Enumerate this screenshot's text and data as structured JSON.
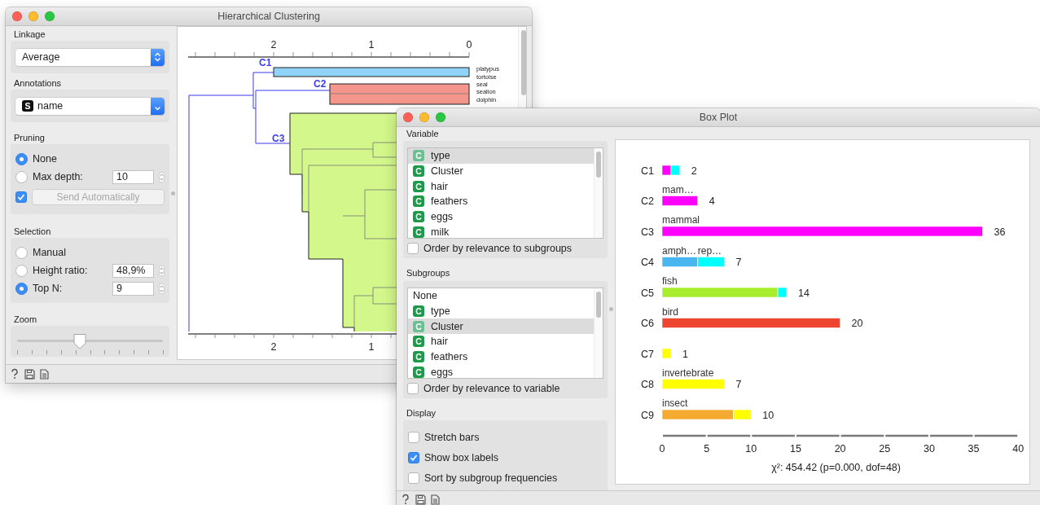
{
  "clustering": {
    "title": "Hierarchical Clustering",
    "linkage": {
      "label": "Linkage",
      "value": "Average"
    },
    "annotations": {
      "label": "Annotations",
      "badge": "S",
      "value": "name"
    },
    "pruning": {
      "label": "Pruning",
      "options": [
        {
          "label": "None",
          "selected": true
        },
        {
          "label": "Max depth:",
          "selected": false,
          "value": "10"
        }
      ],
      "send": {
        "label": "Send Automatically",
        "checked": true,
        "disabled": true
      }
    },
    "selection": {
      "label": "Selection",
      "options": [
        {
          "label": "Manual",
          "selected": false
        },
        {
          "label": "Height ratio:",
          "selected": false,
          "value": "48,9%"
        },
        {
          "label": "Top N:",
          "selected": true,
          "value": "9"
        }
      ]
    },
    "zoom": {
      "label": "Zoom",
      "level": 0.43
    },
    "dendrogram": {
      "top_ticks": [
        "2",
        "1",
        "0"
      ],
      "bottom_ticks": [
        "2",
        "1"
      ],
      "clusters": [
        {
          "label": "C1",
          "color": "#8fd4f8"
        },
        {
          "label": "C2",
          "color": "#f4968b"
        },
        {
          "label": "C3",
          "color": "#d3f78a"
        }
      ],
      "leaves": [
        "platypus",
        "tortoise",
        "seal",
        "sealion",
        "dolphin"
      ]
    }
  },
  "box_plot": {
    "title": "Box Plot",
    "variable": {
      "label": "Variable",
      "items": [
        {
          "kind": "categorical",
          "badge": "C",
          "label": "type",
          "selected": true
        },
        {
          "kind": "categorical",
          "badge": "C",
          "label": "Cluster",
          "selected": false
        },
        {
          "kind": "categorical",
          "badge": "C",
          "label": "hair",
          "selected": false
        },
        {
          "kind": "categorical",
          "badge": "C",
          "label": "feathers",
          "selected": false
        },
        {
          "kind": "categorical",
          "badge": "C",
          "label": "eggs",
          "selected": false
        },
        {
          "kind": "categorical",
          "badge": "C",
          "label": "milk",
          "selected": false
        }
      ],
      "order": {
        "label": "Order by relevance to subgroups",
        "checked": false
      }
    },
    "subgroups": {
      "label": "Subgroups",
      "items": [
        {
          "kind": "none",
          "label": "None",
          "selected": false
        },
        {
          "kind": "categorical",
          "badge": "C",
          "label": "type",
          "selected": false
        },
        {
          "kind": "categorical",
          "badge": "C",
          "label": "Cluster",
          "selected": true
        },
        {
          "kind": "categorical",
          "badge": "C",
          "label": "hair",
          "selected": false
        },
        {
          "kind": "categorical",
          "badge": "C",
          "label": "feathers",
          "selected": false
        },
        {
          "kind": "categorical",
          "badge": "C",
          "label": "eggs",
          "selected": false
        }
      ],
      "order": {
        "label": "Order by relevance to variable",
        "checked": false
      }
    },
    "display": {
      "label": "Display",
      "options": [
        {
          "label": "Stretch bars",
          "checked": false
        },
        {
          "label": "Show box labels",
          "checked": true
        },
        {
          "label": "Sort by subgroup frequencies",
          "checked": false
        }
      ]
    },
    "rows": [
      {
        "count": "2"
      },
      {
        "count": "4",
        "labels": [
          "mam…"
        ]
      },
      {
        "count": "36",
        "labels": [
          "mammal"
        ]
      },
      {
        "count": "7",
        "labels": [
          "amph…",
          "rep…"
        ]
      },
      {
        "count": "14",
        "labels": [
          "fish"
        ]
      },
      {
        "count": "20",
        "labels": [
          "bird"
        ]
      },
      {
        "count": "1"
      },
      {
        "count": "7",
        "labels": [
          "invertebrate"
        ]
      },
      {
        "count": "10",
        "labels": [
          "insect"
        ]
      }
    ],
    "chart_data": {
      "type": "bar",
      "orientation": "horizontal",
      "stacked": true,
      "categories": [
        "C1",
        "C2",
        "C3",
        "C4",
        "C5",
        "C6",
        "C7",
        "C8",
        "C9"
      ],
      "series": [
        {
          "color": "#ff00ff",
          "values": [
            1,
            4,
            36,
            0,
            0,
            0,
            0,
            0,
            0
          ]
        },
        {
          "color": "#4ab6f0",
          "values": [
            0,
            0,
            0,
            4,
            0,
            0,
            0,
            0,
            0
          ]
        },
        {
          "color": "#a8ee2e",
          "values": [
            0,
            0,
            0,
            0,
            13,
            0,
            0,
            0,
            0
          ]
        },
        {
          "color": "#ee4531",
          "values": [
            0,
            0,
            0,
            0,
            0,
            20,
            0,
            0,
            0
          ]
        },
        {
          "color": "#f5ab31",
          "values": [
            0,
            0,
            0,
            0,
            0,
            0,
            0,
            0,
            8
          ]
        },
        {
          "color": "#00ffff",
          "values": [
            1,
            0,
            0,
            3,
            1,
            0,
            0,
            0,
            0
          ]
        },
        {
          "color": "#ffff00",
          "values": [
            0,
            0,
            0,
            0,
            0,
            0,
            1,
            7,
            2
          ]
        }
      ],
      "xlim": [
        0,
        40
      ],
      "xticks": [
        0,
        5,
        10,
        15,
        20,
        25,
        30,
        35,
        40
      ],
      "xlabel": "χ²: 454.42 (p=0.000, dof=48)"
    }
  }
}
